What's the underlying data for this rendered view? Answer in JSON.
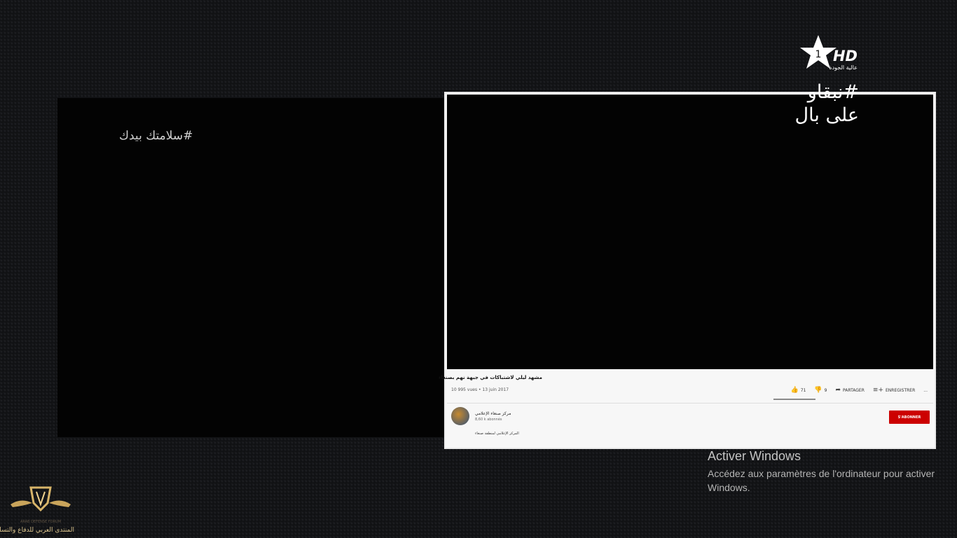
{
  "left_slide": {
    "hashtag": "#سلامتك بيدك"
  },
  "youtube": {
    "video_title": "مشهد ليلي لاشتباكات في جبهة نهم بصنعاء",
    "meta": "10 995 vues • 13 juin 2017",
    "likes": "71",
    "dislikes": "9",
    "share_label": "PARTAGER",
    "save_label": "ENREGISTRER",
    "more_label": "...",
    "channel_name": "مركز صنعاء الإعلامي",
    "subscribers": "8,60 k abonnés",
    "subscribe_label": "S'ABONNER",
    "description": "المركز الإعلامي لمنطقة صنعاء"
  },
  "brand": {
    "hd": "HD",
    "quality": "عالية الجودة",
    "hashtag_line1": "#نبقاو",
    "hashtag_line2": "على بال"
  },
  "windows_activation": {
    "title": "Activer Windows",
    "message": "Accédez aux paramètres de l'ordinateur pour activer Windows."
  },
  "forum": {
    "small_text": "ARAB DEFENSE FORUM",
    "label": "المنتدى العربي للدفاع والتسليح"
  },
  "icons": {
    "like": "thumb-up-icon",
    "dislike": "thumb-down-icon",
    "share": "share-icon",
    "save": "playlist-add-icon",
    "channel_logo": "star-logo-icon",
    "forum_logo": "winged-shield-icon"
  },
  "colors": {
    "subscribe": "#cc0000",
    "background": "#111214",
    "forum_gold": "#d9c28c"
  }
}
